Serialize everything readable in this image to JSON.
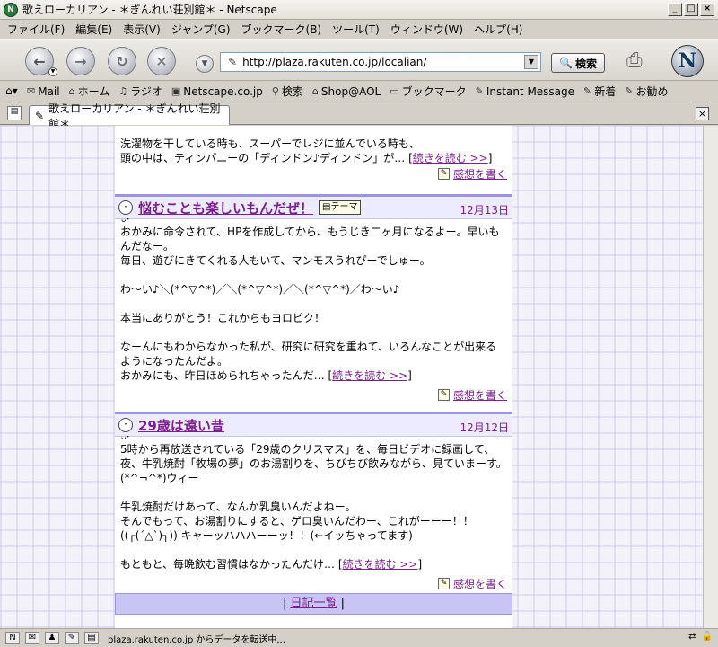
{
  "window": {
    "title": "歌えローカリアン - ＊ぎんれい荘別館＊ - Netscape",
    "app_icon": "N"
  },
  "menubar": {
    "items": [
      "ファイル(F)",
      "編集(E)",
      "表示(V)",
      "ジャンプ(G)",
      "ブックマーク(B)",
      "ツール(T)",
      "ウィンドウ(W)",
      "ヘルプ(H)"
    ]
  },
  "navbar": {
    "url": "http://plaza.rakuten.co.jp/localian/",
    "search_label": "検索",
    "logo": "N"
  },
  "bookmarks": {
    "items": [
      {
        "label": "Mail",
        "icon": "mail-icon"
      },
      {
        "label": "ホーム",
        "icon": "home-icon"
      },
      {
        "label": "ラジオ",
        "icon": "radio-icon"
      },
      {
        "label": "Netscape.co.jp",
        "icon": "my-icon"
      },
      {
        "label": "検索",
        "icon": "search-icon"
      },
      {
        "label": "Shop@AOL",
        "icon": "shop-icon"
      },
      {
        "label": "ブックマーク",
        "icon": "folder-icon"
      },
      {
        "label": "Instant Message",
        "icon": "bookmark-icon"
      },
      {
        "label": "新着",
        "icon": "bookmark-icon"
      },
      {
        "label": "お勧め",
        "icon": "bookmark-icon"
      }
    ]
  },
  "tab": {
    "label": "歌えローカリアン - ＊ぎんれい荘別館＊"
  },
  "entries": {
    "e0": {
      "lines": [
        "洗濯物を干している時も、スーパーでレジに並んでいる時も、",
        "頭の中は、ティンパニーの「ディンドン♪ディンドン」が…"
      ],
      "readmore": "続きを読む >>",
      "comment": "感想を書く"
    },
    "e1": {
      "title": "悩むことも楽しいもんだぜ！",
      "theme": "テーマ",
      "date": "12月13日",
      "lines": [
        "おかみに命令されて、HPを作成してから、もうじき二ヶ月になるよー。早いもんだなー。",
        "毎日、遊びにきてくれる人もいて、マンモスうれぴーでしゅー。",
        "",
        "わ〜い♪＼(*^▽^*)／＼(*^▽^*)／＼(*^▽^*)／わ〜い♪",
        "",
        "本当にありがとう！これからもヨロピク！",
        "",
        "なーんにもわからなかった私が、研究に研究を重ねて、いろんなことが出来るようになったんだよ。",
        "おかみにも、昨日ほめられちゃったんだ…"
      ],
      "readmore": "続きを読む >>",
      "comment": "感想を書く"
    },
    "e2": {
      "title": "29歳は遠い昔",
      "date": "12月12日",
      "lines": [
        "5時から再放送されている「29歳のクリスマス」を、毎日ビデオに録画して、",
        "夜、牛乳焼酎「牧場の夢」のお湯割りを、ちびちび飲みながら、見ていまーす。",
        "(*^¬^*)ウィー",
        "",
        "牛乳焼酎だけあって、なんか乳臭いんだよねー。",
        "そんでもって、お湯割りにすると、ゲロ臭いんだわー、これがーーー！！",
        "((┌(´△`)┐)) キャーッハハハーーッ！！(←イッちゃってます)",
        "",
        "もともと、毎晩飲む習慣はなかったんだけ…"
      ],
      "readmore": "続きを読む >>",
      "comment": "感想を書く"
    }
  },
  "footer": {
    "link": "日記一覧"
  },
  "status": {
    "text": "plaza.rakuten.co.jp からデータを転送中..."
  }
}
